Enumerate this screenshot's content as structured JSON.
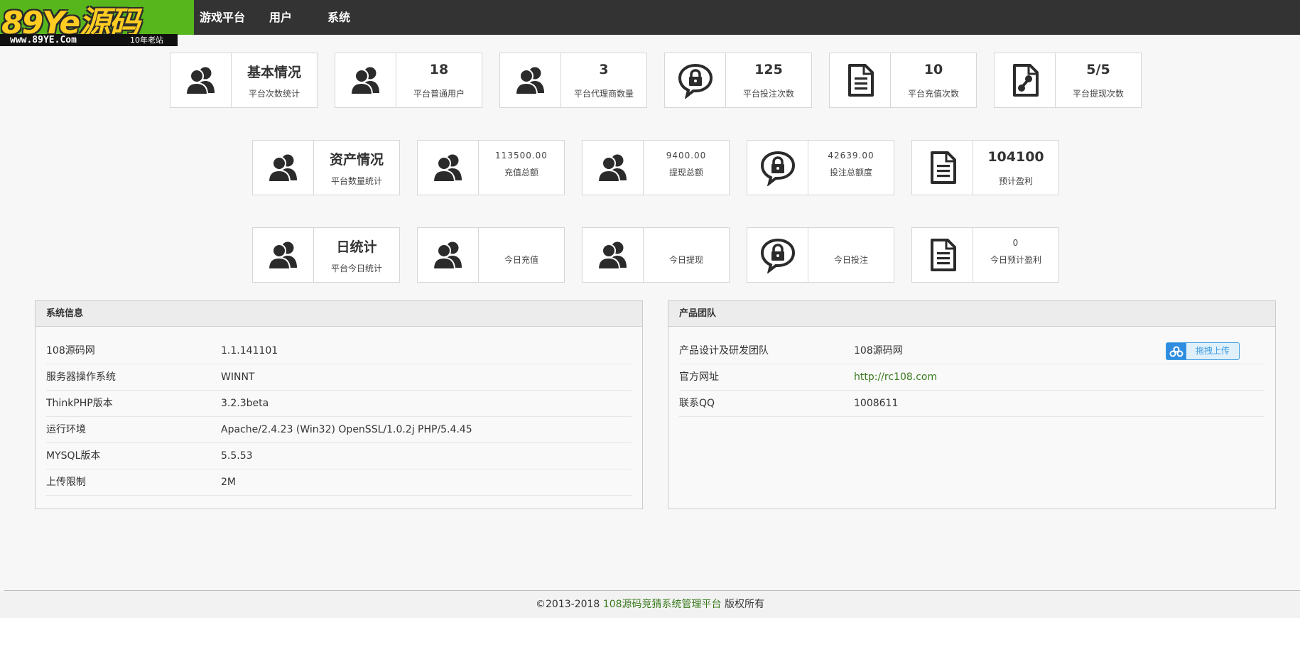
{
  "logo": {
    "main_text": "89Ye源码",
    "url": "www.89YE.Com",
    "badge": "10年老站"
  },
  "nav": {
    "items": [
      "游戏平台",
      "用户",
      "系统"
    ]
  },
  "row1": [
    {
      "title": "基本情况",
      "label": "平台次数统计",
      "icon": "users-icon"
    },
    {
      "value": "18",
      "label": "平台普通用户",
      "icon": "users-icon"
    },
    {
      "value": "3",
      "label": "平台代理商数量",
      "icon": "users-icon"
    },
    {
      "value": "125",
      "label": "平台投注次数",
      "icon": "lock-chat-icon"
    },
    {
      "value": "10",
      "label": "平台充值次数",
      "icon": "document-icon"
    },
    {
      "value": "5/5",
      "label": "平台提现次数",
      "icon": "transfer-file-icon"
    }
  ],
  "row2": [
    {
      "title": "资产情况",
      "label": "平台数量统计",
      "icon": "users-icon"
    },
    {
      "amount": "113500.00",
      "label": "充值总额",
      "icon": "users-icon"
    },
    {
      "amount": "9400.00",
      "label": "提现总额",
      "icon": "users-icon"
    },
    {
      "amount": "42639.00",
      "label": "投注总额度",
      "icon": "lock-chat-icon"
    },
    {
      "value": "104100",
      "label": "预计盈利",
      "icon": "document-icon"
    }
  ],
  "row3": [
    {
      "title": "日统计",
      "label": "平台今日统计",
      "icon": "users-icon"
    },
    {
      "label": "今日充值",
      "icon": "users-icon"
    },
    {
      "label": "今日提现",
      "icon": "users-icon"
    },
    {
      "label": "今日投注",
      "icon": "lock-chat-icon"
    },
    {
      "amount": "0",
      "label": "今日预计盈利",
      "icon": "document-icon"
    }
  ],
  "sysinfo": {
    "title": "系统信息",
    "rows": [
      {
        "k": "108源码网",
        "v": "1.1.141101"
      },
      {
        "k": "服务器操作系统",
        "v": "WINNT"
      },
      {
        "k": "ThinkPHP版本",
        "v": "3.2.3beta"
      },
      {
        "k": "运行环境",
        "v": "Apache/2.4.23 (Win32) OpenSSL/1.0.2j PHP/5.4.45"
      },
      {
        "k": "MYSQL版本",
        "v": "5.5.53"
      },
      {
        "k": "上传限制",
        "v": "2M"
      }
    ]
  },
  "team": {
    "title": "产品团队",
    "rows": [
      {
        "k": "产品设计及研发团队",
        "v": "108源码网"
      },
      {
        "k": "官方网址",
        "v": "http://rc108.com"
      },
      {
        "k": "联系QQ",
        "v": "1008611"
      }
    ],
    "upload_label": "拖拽上传"
  },
  "footer": {
    "copyright": "©2013-2018",
    "brand": "108源码竞猜系统管理平台",
    "suffix": "版权所有"
  },
  "colors": {
    "topbar": "#333333",
    "logo_bg": "#57b61c",
    "link": "#3a7a1e",
    "upload_accent": "#3d9be0"
  }
}
